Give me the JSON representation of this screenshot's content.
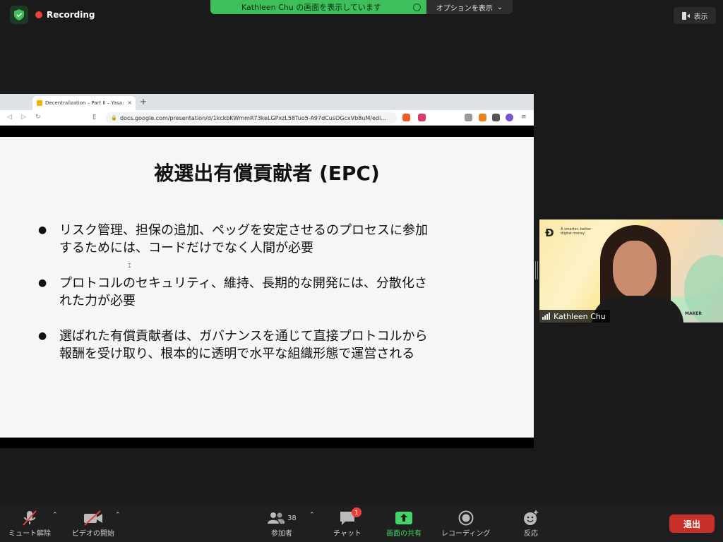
{
  "top": {
    "recording_label": "Recording",
    "share_banner": "Kathleen Chu の画面を表示しています",
    "options_label": "オプションを表示",
    "view_label": "表示"
  },
  "browser": {
    "tab_title": "Decentralization – Part II – Yasa:",
    "tab_close": "×",
    "new_tab": "+",
    "url": "docs.google.com/presentation/d/1kckbKWrnmR73keLGPxzL58Tuo5-A97dCusOGcxVb8uM/edi..."
  },
  "slide": {
    "title": "被選出有償貢献者 (EPC)",
    "bullets": [
      {
        "line1": "リスク管理、担保の追加、ペッグを安定させるのプロセスに参加",
        "line2": "するためには、コードだけでなく人間が必要"
      },
      {
        "line1": "プロトコルのセキュリティ、維持、長期的な開発には、分散化さ",
        "line2": "れた力が必要"
      },
      {
        "line1": "選ばれた有償貢献者は、ガバナンスを通じて直接プロトコルから",
        "line2": "報酬を受け取り、根本的に透明で水平な組織形態で運営される"
      }
    ]
  },
  "video": {
    "name": "Kathleen Chu",
    "logo_text": "A smarter, better digital money",
    "brand": "MAKER"
  },
  "toolbar": {
    "mute": "ミュート解除",
    "video": "ビデオの開始",
    "participants": "参加者",
    "participants_count": "38",
    "chat": "チャット",
    "chat_badge": "1",
    "share": "画面の共有",
    "record": "レコーディング",
    "reactions": "反応",
    "leave": "退出"
  },
  "colors": {
    "share_green": "#3fbf5b",
    "leave_red": "#c8312a",
    "recording_red": "#e8413a"
  }
}
